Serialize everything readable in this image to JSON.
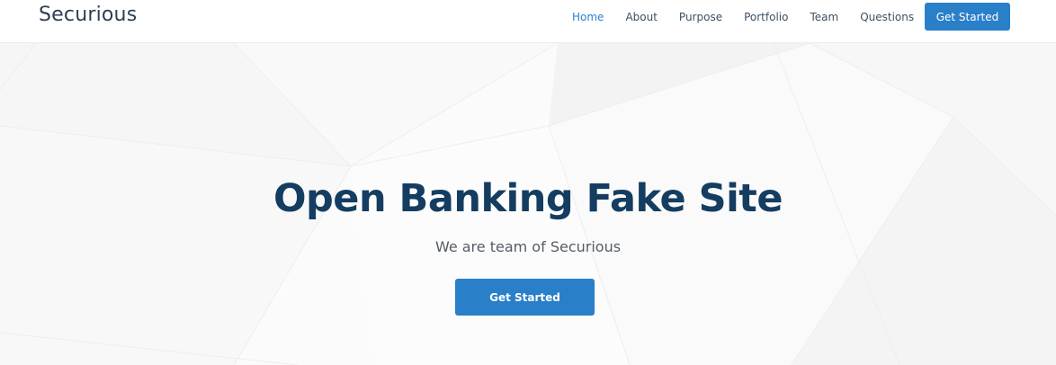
{
  "header": {
    "logo": "Securious",
    "nav": [
      {
        "label": "Home",
        "active": true
      },
      {
        "label": "About",
        "active": false
      },
      {
        "label": "Purpose",
        "active": false
      },
      {
        "label": "Portfolio",
        "active": false
      },
      {
        "label": "Team",
        "active": false
      },
      {
        "label": "Questions",
        "active": false
      }
    ],
    "cta_label": "Get Started"
  },
  "hero": {
    "title": "Open Banking Fake Site",
    "subtitle": "We are team of Securious",
    "cta_label": "Get Started"
  },
  "colors": {
    "accent": "#2a7fc9",
    "title": "#143d61",
    "nav_text": "#3d5166",
    "logo": "#2d3f52"
  }
}
